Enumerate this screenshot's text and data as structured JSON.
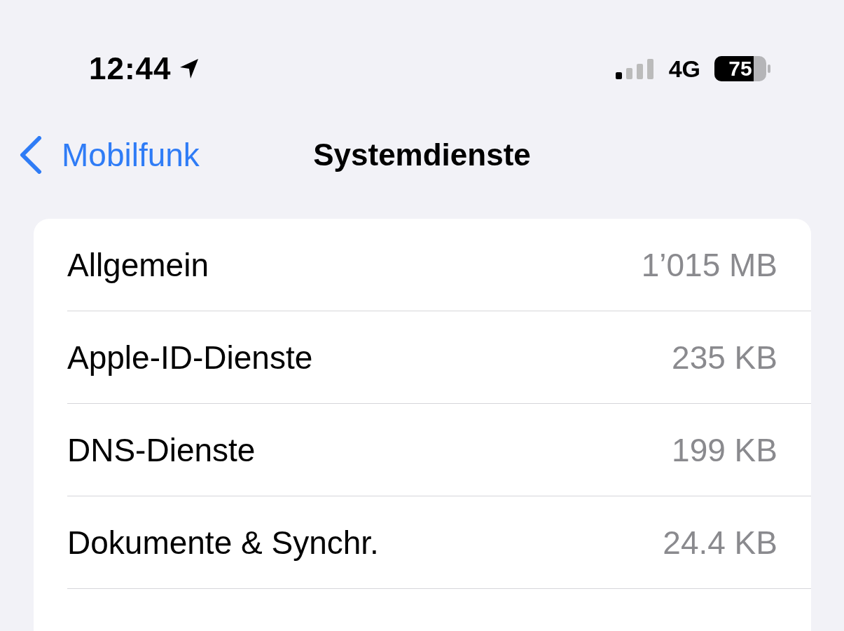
{
  "status_bar": {
    "time": "12:44",
    "network": "4G",
    "battery": "75"
  },
  "nav": {
    "back": "Mobilfunk",
    "title": "Systemdienste"
  },
  "rows": [
    {
      "label": "Allgemein",
      "value": "1’015 MB"
    },
    {
      "label": "Apple-ID-Dienste",
      "value": "235 KB"
    },
    {
      "label": "DNS-Dienste",
      "value": "199 KB"
    },
    {
      "label": "Dokumente & Synchr.",
      "value": "24.4 KB"
    }
  ]
}
